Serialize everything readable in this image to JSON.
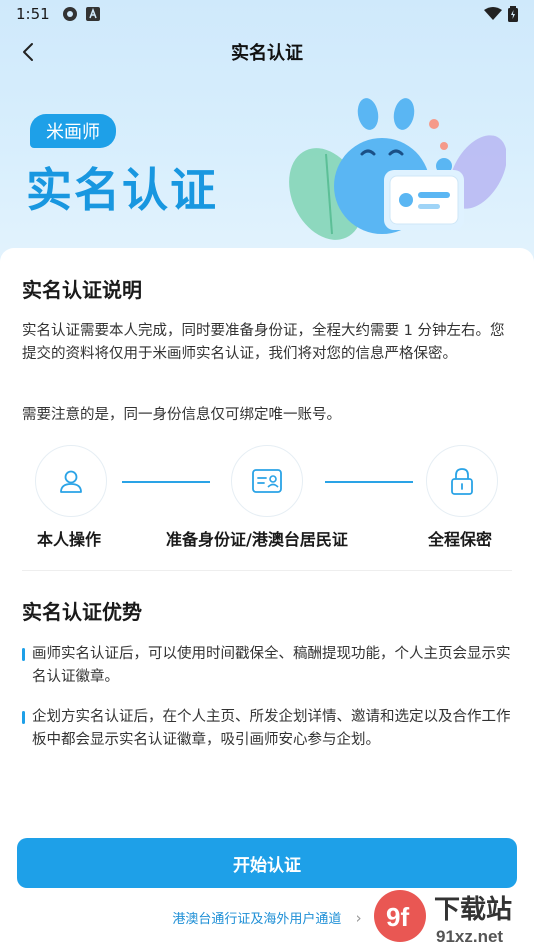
{
  "status_bar": {
    "time": "1:51"
  },
  "nav": {
    "title": "实名认证"
  },
  "banner": {
    "brand": "米画师",
    "title": "实名认证"
  },
  "info_section": {
    "title": "实名认证说明",
    "paragraph1": "实名认证需要本人完成，同时要准备身份证，全程大约需要 1 分钟左右。您提交的资料将仅用于米画师实名认证，我们将对您的信息严格保密。",
    "paragraph2": "需要注意的是，同一身份信息仅可绑定唯一账号。"
  },
  "steps": [
    {
      "label": "本人操作",
      "icon": "person-icon"
    },
    {
      "label": "准备身份证/港澳台居民证",
      "icon": "id-card-icon"
    },
    {
      "label": "全程保密",
      "icon": "lock-icon"
    }
  ],
  "advantages": {
    "title": "实名认证优势",
    "items": [
      "画师实名认证后，可以使用时间戳保全、稿酬提现功能，个人主页会显示实名认证徽章。",
      "企划方实名认证后，在个人主页、所发企划详情、邀请和选定以及合作工作板中都会显示实名认证徽章，吸引画师安心参与企划。"
    ]
  },
  "actions": {
    "start_button": "开始认证",
    "overseas_link": "港澳台通行证及海外用户通道"
  },
  "watermark": {
    "text1": "下载站",
    "text2": "91xz.net"
  },
  "colors": {
    "accent": "#1ea0e8",
    "banner_bg": "#d3ebfc"
  }
}
